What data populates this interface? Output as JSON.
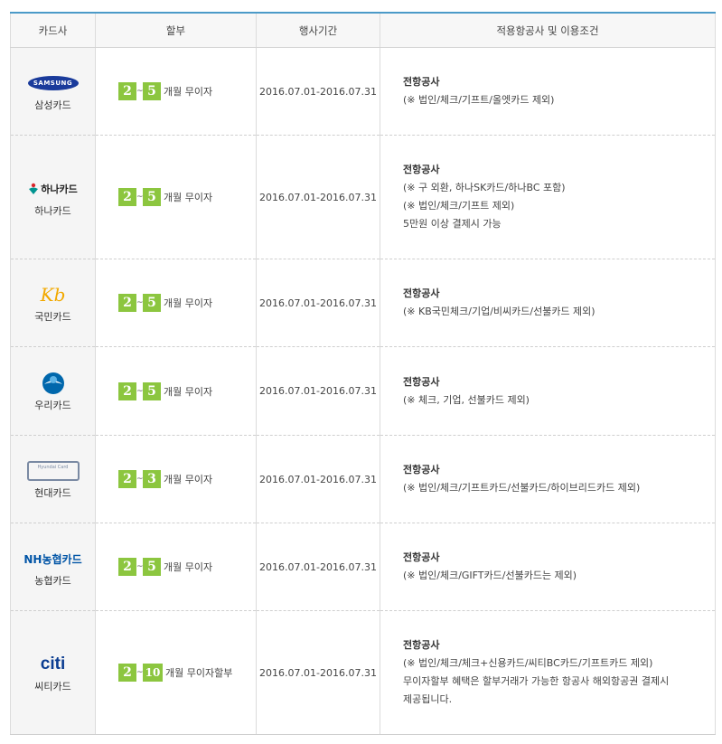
{
  "headers": [
    "카드사",
    "할부",
    "행사기간",
    "적용항공사 및 이용조건"
  ],
  "rows": [
    {
      "logo_icon": "samsung-card-logo",
      "logo_text": "SAMSUNG",
      "card": "삼성카드",
      "from": "2",
      "tilde": "~",
      "to": "5",
      "inst_text": "개월 무이자",
      "period": "2016.07.01-2016.07.31",
      "cond_title": "전항공사",
      "cond_lines": [
        "(※ 법인/체크/기프트/올엣카드 제외)"
      ]
    },
    {
      "logo_icon": "hana-card-logo",
      "logo_text": "하나카드",
      "card": "하나카드",
      "from": "2",
      "tilde": "~",
      "to": "5",
      "inst_text": "개월 무이자",
      "period": "2016.07.01-2016.07.31",
      "cond_title": "전항공사",
      "cond_lines": [
        "(※ 구 외환, 하나SK카드/하나BC 포함)",
        "(※ 법인/체크/기프트 제외)",
        "5만원 이상 결제시 가능"
      ]
    },
    {
      "logo_icon": "kb-card-logo",
      "logo_text": "Kb",
      "card": "국민카드",
      "from": "2",
      "tilde": "~",
      "to": "5",
      "inst_text": "개월 무이자",
      "period": "2016.07.01-2016.07.31",
      "cond_title": "전항공사",
      "cond_lines": [
        "(※ KB국민체크/기업/비씨카드/선불카드 제외)"
      ]
    },
    {
      "logo_icon": "woori-card-logo",
      "logo_text": "",
      "card": "우리카드",
      "from": "2",
      "tilde": "~",
      "to": "5",
      "inst_text": "개월 무이자",
      "period": "2016.07.01-2016.07.31",
      "cond_title": "전항공사",
      "cond_lines": [
        "(※ 체크, 기업, 선불카드 제외)"
      ]
    },
    {
      "logo_icon": "hyundai-card-logo",
      "logo_text": "Hyundai Card",
      "card": "현대카드",
      "from": "2",
      "tilde": "~",
      "to": "3",
      "inst_text": "개월 무이자",
      "period": "2016.07.01-2016.07.31",
      "cond_title": "전항공사",
      "cond_lines": [
        "(※ 법인/체크/기프트카드/선불카드/하이브리드카드 제외)"
      ]
    },
    {
      "logo_icon": "nh-card-logo",
      "logo_text": "NH농협카드",
      "card": "농협카드",
      "from": "2",
      "tilde": "~",
      "to": "5",
      "inst_text": "개월 무이자",
      "period": "2016.07.01-2016.07.31",
      "cond_title": "전항공사",
      "cond_lines": [
        "(※ 법인/체크/GIFT카드/선불카드는 제외)"
      ]
    },
    {
      "logo_icon": "citi-card-logo",
      "logo_text": "citi",
      "card": "씨티카드",
      "from": "2",
      "tilde": "~",
      "to": "10",
      "inst_text": "개월 무이자할부",
      "period": "2016.07.01-2016.07.31",
      "cond_title": "전항공사",
      "cond_lines": [
        "(※ 법인/체크/체크+신용카드/씨티BC카드/기프트카드 제외)",
        "무이자할부 혜택은 할부거래가 가능한 항공사 해외항공권 결제시",
        "제공됩니다."
      ]
    }
  ],
  "colors": {
    "accent_border": "#4b9ac8",
    "badge_green": "#8cc63f",
    "samsung_blue": "#1a3b9b",
    "hana_green": "#009490",
    "kb_yellow": "#f2a900",
    "woori_blue": "#0067ac",
    "nh_blue": "#0054a6",
    "citi_blue": "#0b3d91",
    "citi_red": "#d92b2b"
  }
}
